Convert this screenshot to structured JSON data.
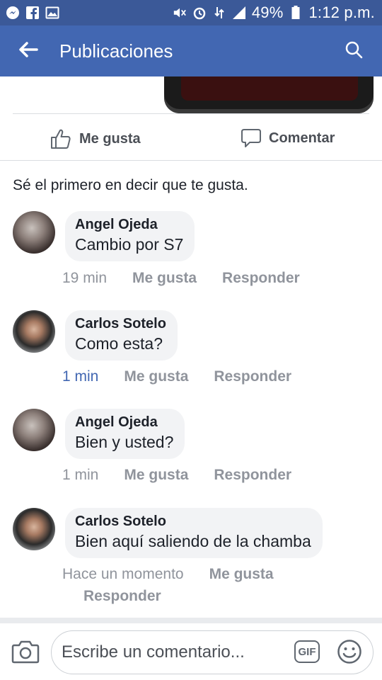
{
  "status_bar": {
    "battery": "49%",
    "time": "1:12 p.m."
  },
  "app_bar": {
    "title": "Publicaciones"
  },
  "post_actions": {
    "like_label": "Me gusta",
    "comment_label": "Comentar"
  },
  "first_like_text": "Sé el primero en decir que te gusta.",
  "comments": [
    {
      "author": "Angel Ojeda",
      "text": "Cambio por S7",
      "time": "19 min",
      "like": "Me gusta",
      "reply": "Responder"
    },
    {
      "author": "Carlos Sotelo",
      "text": "Como esta?",
      "time": "1 min",
      "like": "Me gusta",
      "reply": "Responder"
    },
    {
      "author": "Angel Ojeda",
      "text": "Bien y usted?",
      "time": "1 min",
      "like": "Me gusta",
      "reply": "Responder"
    },
    {
      "author": "Carlos Sotelo",
      "text": "Bien aquí saliendo de la chamba",
      "time": "Hace un momento",
      "like": "Me gusta",
      "reply": "Responder"
    }
  ],
  "composer": {
    "placeholder": "Escribe un comentario...",
    "gif_label": "GIF"
  },
  "colors": {
    "status_bar": "#3b5998",
    "app_bar": "#4267b2",
    "bubble": "#f2f3f5",
    "meta_text": "#90949c",
    "highlight_time": "#4267b2"
  },
  "icons": {
    "status_left": [
      "messenger-icon",
      "facebook-icon",
      "gallery-icon"
    ],
    "status_right": [
      "mute-icon",
      "alarm-icon",
      "data-icon",
      "signal-icon",
      "battery-icon"
    ],
    "app_bar": [
      "back-arrow-icon",
      "search-icon"
    ],
    "actions": [
      "thumbs-up-icon",
      "comment-bubble-icon"
    ],
    "composer": [
      "camera-icon",
      "gif-icon",
      "emoji-icon"
    ]
  }
}
